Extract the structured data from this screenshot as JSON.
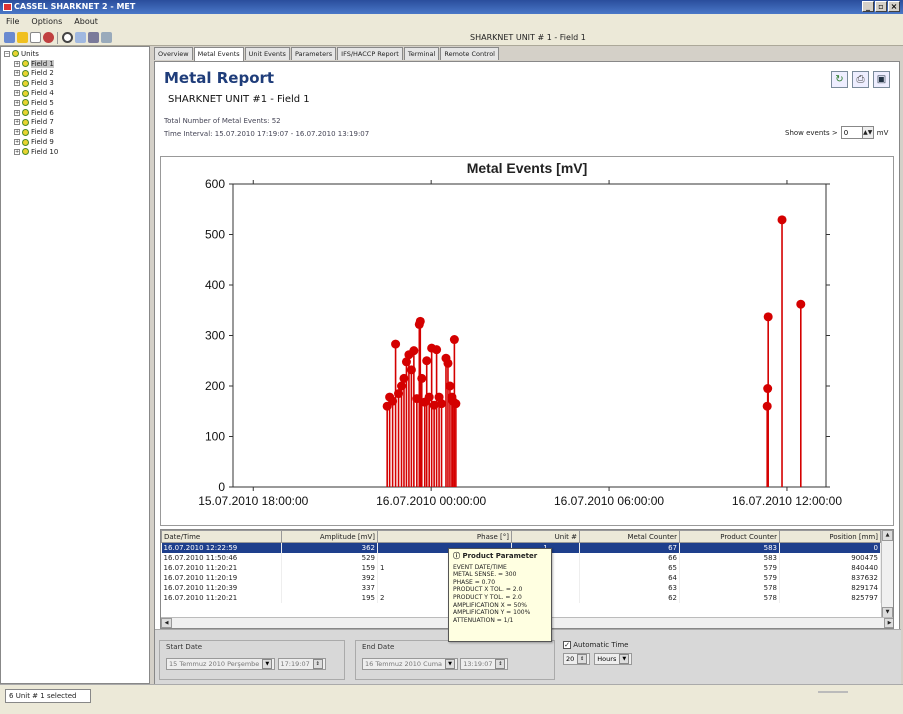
{
  "window": {
    "title": "CASSEL SHARKNET 2 - MET"
  },
  "menu": {
    "file": "File",
    "options": "Options",
    "about": "About"
  },
  "toolbar": {
    "selected_title": "SHARKNET UNIT # 1 - Field 1"
  },
  "tree": {
    "root": "Units",
    "items": [
      "Field 1",
      "Field 2",
      "Field 3",
      "Field 4",
      "Field 5",
      "Field 6",
      "Field 7",
      "Field 8",
      "Field 9",
      "Field 10"
    ]
  },
  "tabs": [
    "Overview",
    "Metal Events",
    "Unit Events",
    "Parameters",
    "IFS/HACCP Report",
    "Terminal",
    "Remote Control"
  ],
  "report": {
    "title": "Metal Report",
    "unit_line": "SHARKNET UNIT #1 - Field 1",
    "total_events": "Total Number of Metal Events: 52",
    "time_interval": "Time Interval: 15.07.2010 17:19:07 - 16.07.2010 13:19:07",
    "show_events_label": "Show events >",
    "show_events_value": "0",
    "show_events_unit": "mV"
  },
  "chart_data": {
    "type": "scatter",
    "title": "Metal Events [mV]",
    "xlabel": "",
    "ylabel": "",
    "x_is_time": true,
    "x_range": [
      "2010-07-15 17:19",
      "2010-07-16 13:19"
    ],
    "ylim": [
      0,
      600
    ],
    "yticks": [
      0,
      100,
      200,
      300,
      400,
      500,
      600
    ],
    "xticks": [
      {
        "at": "2010-07-15 18:00",
        "label": "15.07.2010 18:00:00"
      },
      {
        "at": "2010-07-16 00:00",
        "label": "16.07.2010 00:00:00"
      },
      {
        "at": "2010-07-16 06:00",
        "label": "16.07.2010 06:00:00"
      },
      {
        "at": "2010-07-16 12:00",
        "label": "16.07.2010 12:00:00"
      }
    ],
    "marker_color": "#d40000",
    "grid": false,
    "series": [
      {
        "points": [
          {
            "x": "2010-07-15 22:31",
            "y": 160
          },
          {
            "x": "2010-07-15 22:36",
            "y": 178
          },
          {
            "x": "2010-07-15 22:42",
            "y": 170
          },
          {
            "x": "2010-07-15 22:48",
            "y": 283
          },
          {
            "x": "2010-07-15 22:54",
            "y": 185
          },
          {
            "x": "2010-07-15 23:00",
            "y": 200
          },
          {
            "x": "2010-07-15 23:05",
            "y": 215
          },
          {
            "x": "2010-07-15 23:10",
            "y": 248
          },
          {
            "x": "2010-07-15 23:15",
            "y": 262
          },
          {
            "x": "2010-07-15 23:20",
            "y": 232
          },
          {
            "x": "2010-07-15 23:25",
            "y": 270
          },
          {
            "x": "2010-07-15 23:31",
            "y": 175
          },
          {
            "x": "2010-07-15 23:36",
            "y": 322
          },
          {
            "x": "2010-07-15 23:38",
            "y": 328
          },
          {
            "x": "2010-07-15 23:41",
            "y": 215
          },
          {
            "x": "2010-07-15 23:47",
            "y": 168
          },
          {
            "x": "2010-07-15 23:51",
            "y": 250
          },
          {
            "x": "2010-07-15 23:56",
            "y": 178
          },
          {
            "x": "2010-07-16 00:01",
            "y": 275
          },
          {
            "x": "2010-07-16 00:06",
            "y": 162
          },
          {
            "x": "2010-07-16 00:11",
            "y": 272
          },
          {
            "x": "2010-07-16 00:16",
            "y": 178
          },
          {
            "x": "2010-07-16 00:21",
            "y": 165
          },
          {
            "x": "2010-07-16 00:30",
            "y": 255
          },
          {
            "x": "2010-07-16 00:34",
            "y": 245
          },
          {
            "x": "2010-07-16 00:38",
            "y": 200
          },
          {
            "x": "2010-07-16 00:42",
            "y": 178
          },
          {
            "x": "2010-07-16 00:44",
            "y": 170
          },
          {
            "x": "2010-07-16 00:47",
            "y": 292
          },
          {
            "x": "2010-07-16 00:50",
            "y": 165
          },
          {
            "x": "2010-07-16 11:20",
            "y": 160
          },
          {
            "x": "2010-07-16 11:21",
            "y": 195
          },
          {
            "x": "2010-07-16 11:22",
            "y": 337
          },
          {
            "x": "2010-07-16 11:50",
            "y": 529
          },
          {
            "x": "2010-07-16 12:28",
            "y": 362
          }
        ]
      }
    ]
  },
  "table": {
    "columns": [
      "Date/Time",
      "Amplitude [mV]",
      "Phase [°]",
      "Unit #",
      "Metal Counter",
      "Product Counter",
      "Position [mm]"
    ],
    "rows": [
      [
        "16.07.2010 12:22:59",
        "362",
        "",
        "1",
        "67",
        "583",
        "0"
      ],
      [
        "16.07.2010 11:50:46",
        "529",
        "",
        "1",
        "66",
        "583",
        "900475"
      ],
      [
        "16.07.2010 11:20:21",
        "159",
        "1",
        "1",
        "65",
        "579",
        "840440"
      ],
      [
        "16.07.2010 11:20:19",
        "392",
        "",
        "1",
        "64",
        "579",
        "837632"
      ],
      [
        "16.07.2010 11:20:39",
        "337",
        "",
        "1",
        "63",
        "578",
        "829174"
      ],
      [
        "16.07.2010 11:20:21",
        "195",
        "2",
        "1",
        "62",
        "578",
        "825797"
      ]
    ]
  },
  "tooltip": {
    "title": "Product Parameter",
    "lines": [
      "EVENT DATE/TIME",
      "METAL SENSE. = 300",
      "PHASE = 0.70",
      "PRODUCT X TOL. = 2.0",
      "PRODUCT Y TOL. = 2.0",
      "AMPLIFICATION X = 50%",
      "AMPLIFICATION Y = 100%",
      "ATTENUATION = 1/1"
    ]
  },
  "bottom": {
    "start_date_label": "Start Date",
    "start_date_value": "15 Temmuz 2010 Perşembe",
    "start_time_value": "17:19:07",
    "end_date_label": "End Date",
    "end_date_value": "16 Temmuz 2010 Cuma",
    "end_time_value": "13:19:07",
    "auto_time_label": "Automatic Time",
    "auto_time_value": "20",
    "auto_time_unit": "Hours"
  },
  "status": {
    "text": "Unit # 1 selected",
    "prefix": "6"
  }
}
